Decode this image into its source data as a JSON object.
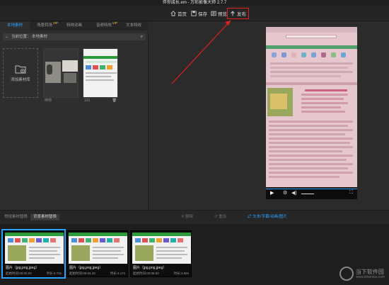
{
  "app": {
    "title": "伴你成长.em - 万彩影像大师 2.7.7"
  },
  "toolbar": {
    "home": "首页",
    "save": "保存",
    "preview": "预览",
    "publish": "发布"
  },
  "tabs": [
    {
      "label": "本地素材",
      "vip": false
    },
    {
      "label": "场景转场",
      "vip": true
    },
    {
      "label": "特效动画",
      "vip": false
    },
    {
      "label": "音频特效",
      "vip": true
    },
    {
      "label": "文本特效",
      "vip": false
    }
  ],
  "vip_badge": "VIP",
  "path": {
    "label": "当前位置：",
    "value": "本地素材"
  },
  "tiles": {
    "add_label": "添加素材库",
    "items": [
      {
        "caption": "伴你"
      },
      {
        "caption": "121"
      }
    ]
  },
  "midbar": {
    "tab_normal": "常规素材替换",
    "tab_bg": "背景素材替换",
    "action1": "删除",
    "action2": "重设",
    "action3": "文本/字幕/动画/图片"
  },
  "timeline": {
    "clips": [
      {
        "title": "图片（jpg,png,jpeg）",
        "start": "起始时间:00:00.00",
        "dur": "时长:4.73s"
      },
      {
        "title": "图片（jpg,png,jpeg）",
        "start": "起始时间:00:04.20",
        "dur": "时长:4.17s"
      },
      {
        "title": "图片（jpg,png,jpeg）",
        "start": "起始时间:00:08.00",
        "dur": "时长:3.99s"
      }
    ]
  },
  "watermark": {
    "name": "当下软件园",
    "sub": "www.downxia.com"
  },
  "colors": {
    "accent": "#29a3ff",
    "highlight": "#e02020",
    "vip": "#f0c030"
  }
}
